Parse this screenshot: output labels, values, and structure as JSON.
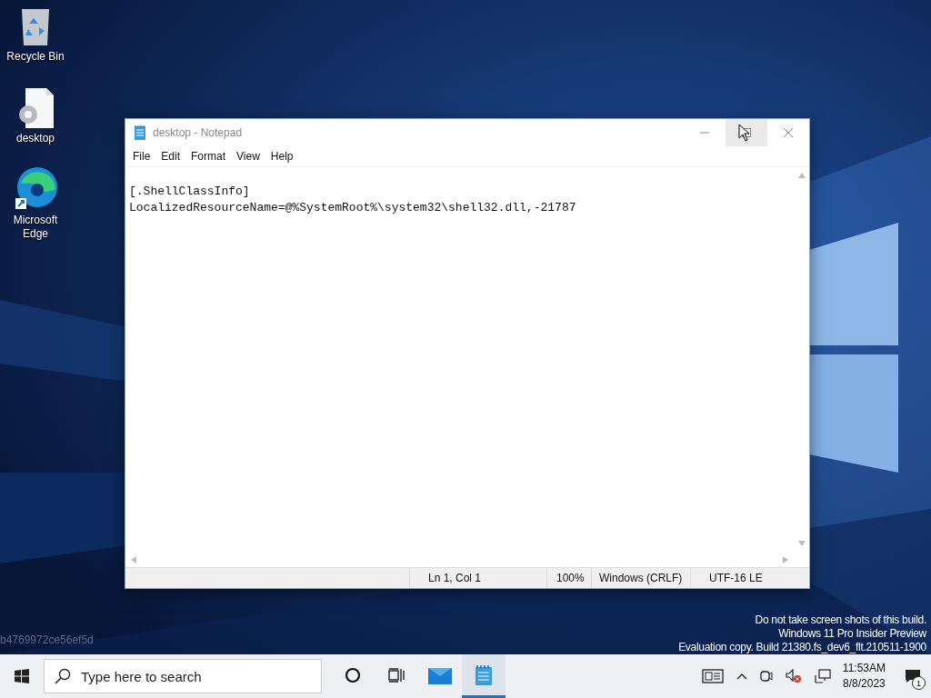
{
  "desktop_icons": [
    {
      "kind": "recycle-bin",
      "label": "Recycle Bin"
    },
    {
      "kind": "settings-file",
      "label": "desktop"
    },
    {
      "kind": "browser",
      "label": "Microsoft Edge"
    }
  ],
  "notepad": {
    "title": "desktop - Notepad",
    "controls": [
      {
        "kind": "minimize",
        "hovered": false
      },
      {
        "kind": "maximize",
        "hovered": true
      },
      {
        "kind": "close",
        "hovered": false
      }
    ],
    "menu": [
      "File",
      "Edit",
      "Format",
      "View",
      "Help"
    ],
    "lines": [
      "[.ShellClassInfo]",
      "LocalizedResourceName=@%SystemRoot%\\system32\\shell32.dll,-21787"
    ],
    "status_bar": [
      "Ln 1, Col 1",
      "100%",
      "Windows (CRLF)",
      "UTF-16 LE"
    ]
  },
  "build_id": "b4769972ce56ef5d",
  "build_info": [
    "Do not take screen shots of this build.",
    "Windows 11 Pro Insider Preview",
    "Evaluation copy. Build 21380.fs_dev6_flt.210511-1900"
  ],
  "taskbar": {
    "search": {
      "placeholder": "Type here to search"
    },
    "apps": [
      {
        "kind": "cortana",
        "selected": false
      },
      {
        "kind": "task-view",
        "selected": false
      },
      {
        "kind": "mail",
        "selected": false
      },
      {
        "kind": "notepad",
        "selected": true
      }
    ],
    "tray": [
      {
        "kind": "news"
      },
      {
        "kind": "chevron"
      },
      {
        "kind": "meet"
      },
      {
        "kind": "volume-muted"
      },
      {
        "kind": "network"
      }
    ],
    "time": "11:53AM",
    "date": "8/8/2023",
    "notifications": "1"
  }
}
